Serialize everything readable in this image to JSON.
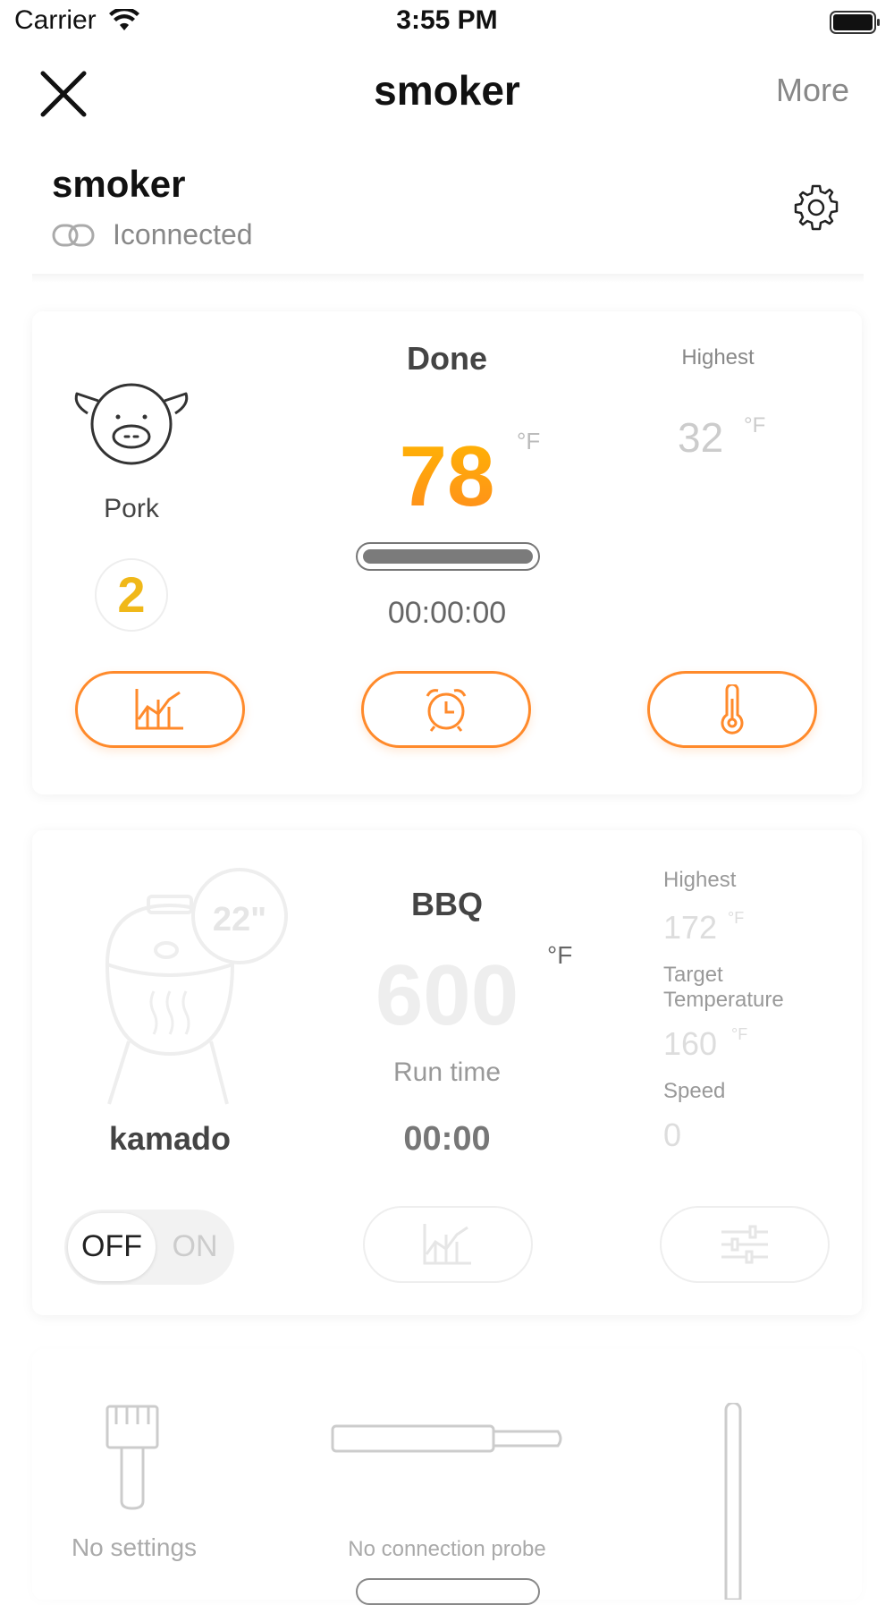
{
  "status_bar": {
    "carrier": "Carrier",
    "time": "3:55 PM"
  },
  "nav": {
    "title": "smoker",
    "more_label": "More"
  },
  "device": {
    "name": "smoker",
    "status": "Iconnected"
  },
  "probe_card": {
    "food_label": "Pork",
    "probe_number": "2",
    "status": "Done",
    "current_temp": "78",
    "unit": "°F",
    "progress": 1.0,
    "elapsed": "00:00:00",
    "highest_label": "Highest",
    "highest_value": "32",
    "highest_unit": "°F",
    "accent_color": "#ff8a2b"
  },
  "grill_card": {
    "grill_size_badge": "22\"",
    "grill_label": "kamado",
    "mode": "BBQ",
    "setpoint": "600",
    "unit": "°F",
    "runtime_label": "Run time",
    "runtime_value": "00:00",
    "highest_label": "Highest",
    "highest_value": "172",
    "highest_unit": "°F",
    "target_label_line1": "Target",
    "target_label_line2": "Temperature",
    "target_value": "160",
    "target_unit": "°F",
    "speed_label": "Speed",
    "speed_value": "0",
    "toggle_off": "OFF",
    "toggle_on": "ON"
  },
  "empty_card": {
    "no_settings": "No settings",
    "no_probe": "No connection probe"
  }
}
